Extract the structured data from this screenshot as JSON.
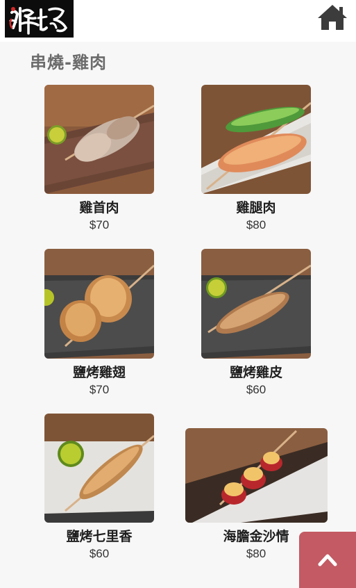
{
  "header": {
    "logo_text": "燊場",
    "home_icon": "home-icon"
  },
  "section": {
    "title": "串燒-雞肉"
  },
  "items": [
    {
      "name": "雞首肉",
      "price": "$70"
    },
    {
      "name": "雞腿肉",
      "price": "$80"
    },
    {
      "name": "鹽烤雞翅",
      "price": "$70"
    },
    {
      "name": "鹽烤雞皮",
      "price": "$60"
    },
    {
      "name": "鹽烤七里香",
      "price": "$60"
    },
    {
      "name": "海膽金沙情",
      "price": "$80"
    }
  ],
  "back_to_top": {
    "icon": "chevron-up-icon"
  },
  "colors": {
    "accent": "#c35a64",
    "title_gray": "#6b6b6b",
    "logo_bg": "#0c0c0c",
    "home_icon": "#3c3c3c"
  }
}
